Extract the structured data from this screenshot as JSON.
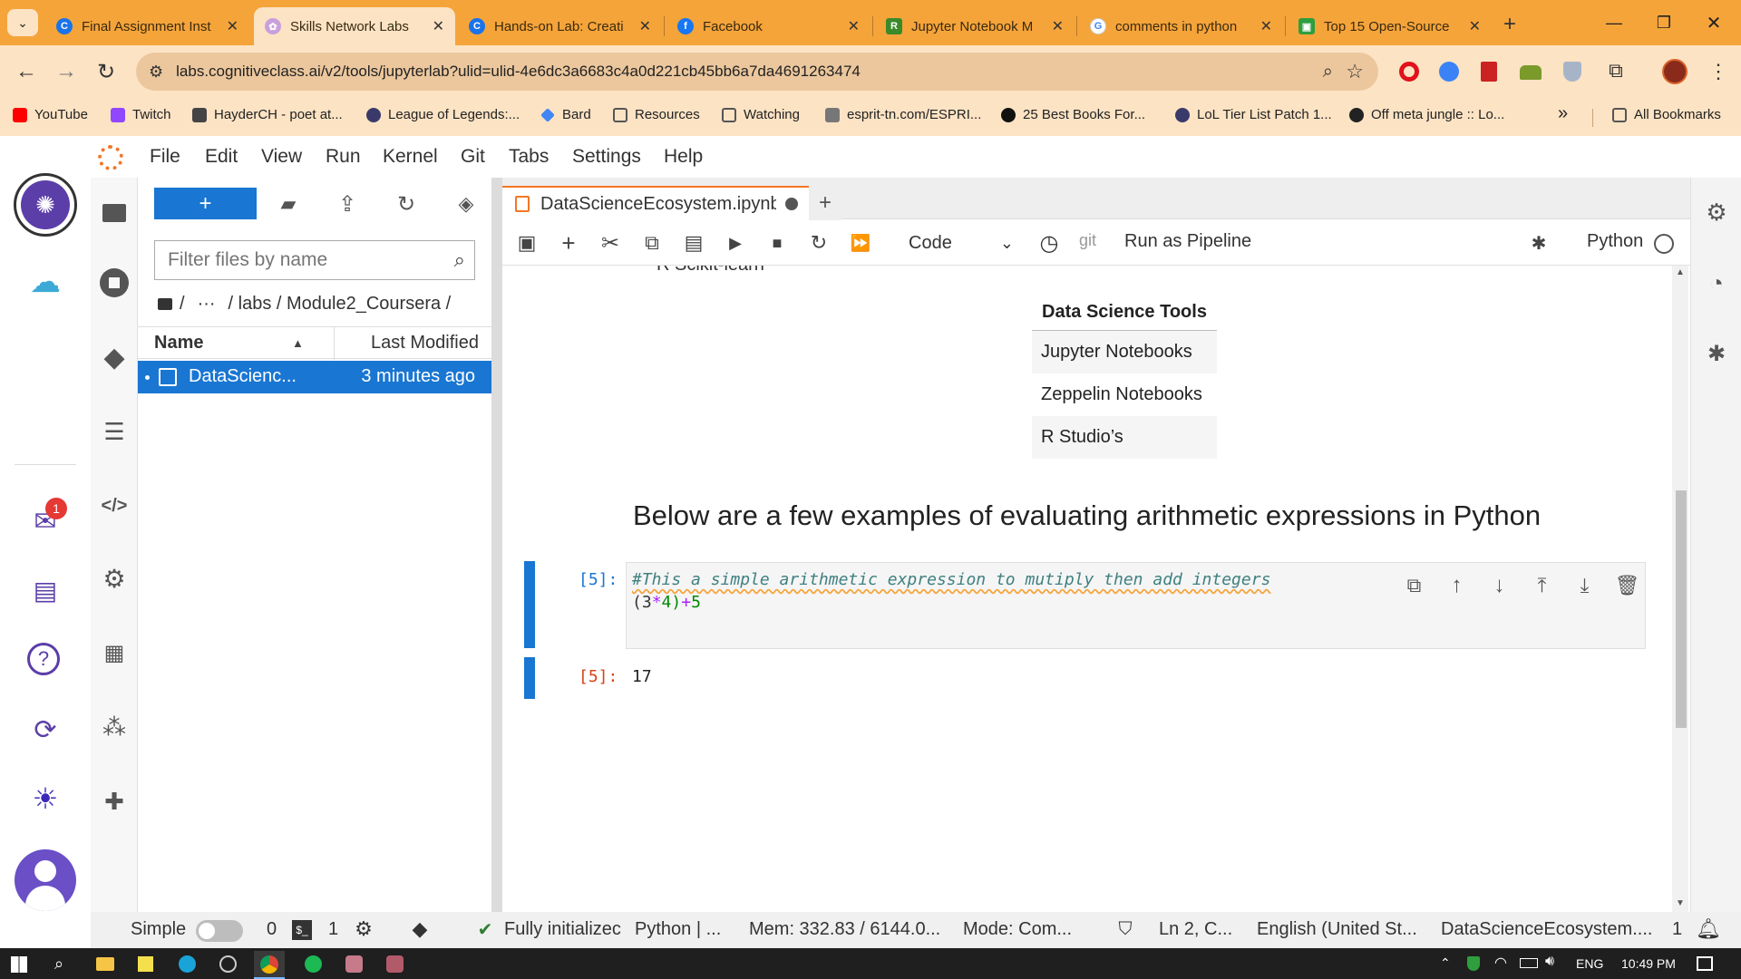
{
  "browser": {
    "tabs": [
      {
        "title": "Final Assignment Inst",
        "favicon_color": "#1a73e8",
        "glyph": "C"
      },
      {
        "title": "Skills Network Labs",
        "favicon_color": "#c9a0dc",
        "glyph": "✿"
      },
      {
        "title": "Hands-on Lab: Creati",
        "favicon_color": "#1a73e8",
        "glyph": "C"
      },
      {
        "title": "Facebook",
        "favicon_color": "#1877f2",
        "glyph": "f"
      },
      {
        "title": "Jupyter Notebook M",
        "favicon_color": "#3a8a2a",
        "glyph": "R"
      },
      {
        "title": "comments in python",
        "favicon_color": "#4285f4",
        "glyph": "G"
      },
      {
        "title": "Top 15 Open-Source",
        "favicon_color": "#2e9e3e",
        "glyph": "▣"
      }
    ],
    "close_glyph": "✕",
    "new_tab_glyph": "+",
    "url": "labs.cognitiveclass.ai/v2/tools/jupyterlab?ulid=ulid-4e6dc3a6683c4a0d221cb45bb6a7da4691263474",
    "bookmarks": [
      {
        "label": "YouTube",
        "color": "#ff0000"
      },
      {
        "label": "Twitch",
        "color": "#9146ff"
      },
      {
        "label": "HayderCH - poet at...",
        "color": "#333333"
      },
      {
        "label": "League of Legends:...",
        "color": "#3a3a6a"
      },
      {
        "label": "Bard",
        "color": "#4285f4"
      },
      {
        "label": "Resources",
        "color": "#555555"
      },
      {
        "label": "Watching",
        "color": "#555555"
      },
      {
        "label": "esprit-tn.com/ESPRI...",
        "color": "#777777"
      },
      {
        "label": "25 Best Books For...",
        "color": "#111111"
      },
      {
        "label": "LoL Tier List Patch 1...",
        "color": "#3a3a6a"
      },
      {
        "label": "Off meta jungle :: Lo...",
        "color": "#222222"
      }
    ],
    "more_glyph": "»",
    "all_bookmarks": "All Bookmarks"
  },
  "menu": [
    "File",
    "Edit",
    "View",
    "Run",
    "Kernel",
    "Git",
    "Tabs",
    "Settings",
    "Help"
  ],
  "sidebar": {
    "inbox_badge": "1"
  },
  "filebrowser": {
    "new_button": "+",
    "filter_placeholder": "Filter files by name",
    "breadcrumb_dots": "···",
    "breadcrumb_path": "/ labs / Module2_Coursera /",
    "col_name": "Name",
    "col_modified": "Last Modified",
    "files": [
      {
        "name": "DataScienc...",
        "modified": "3 minutes ago"
      }
    ]
  },
  "notebook": {
    "tab_title": "DataScienceEcosystem.ipynb",
    "cell_type": "Code",
    "git_label": "git",
    "run_pipeline": "Run as Pipeline",
    "kernel": "Python",
    "partial_text": "R Scikit-learn",
    "table_header": "Data Science Tools",
    "table_rows": [
      "Jupyter Notebooks",
      "Zeppelin Notebooks",
      "R Studio’s"
    ],
    "heading": "Below are a few examples of evaluating arithmetic expressions in Python",
    "cell_prompt": "[5]:",
    "code_comment": "#This a simple arithmetic expression to mutiply then add integers",
    "code_line2_a": "(3",
    "code_line2_op1": "*",
    "code_line2_b": "4)",
    "code_line2_op2": "+",
    "code_line2_c": "5",
    "output_prompt": "[5]:",
    "output_value": "17"
  },
  "status": {
    "mode_label": "Simple",
    "count0": "0",
    "term_count": "1",
    "kernel_status": "Fully initializec",
    "kernel_name": "Python | ...",
    "mem": "Mem: 332.83 / 6144.0...",
    "mode": "Mode: Com...",
    "position": "Ln 2, C...",
    "language": "English (United St...",
    "filename": "DataScienceEcosystem....",
    "notifications": "1"
  },
  "taskbar": {
    "lang": "ENG",
    "time": "10:49 PM"
  },
  "colors": {
    "tabstrip": "#f5a43a",
    "toolbar": "#fce3c4",
    "jupyter_blue": "#1976d2",
    "active_row": "#1976d2",
    "prompt_orange": "#d84315",
    "comment_color": "#408080"
  }
}
